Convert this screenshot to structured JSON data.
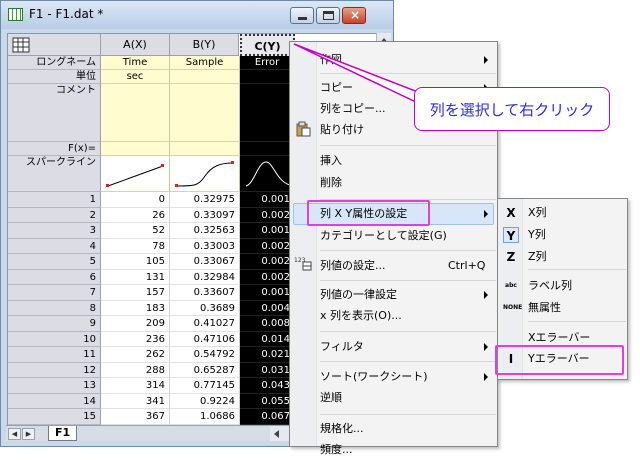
{
  "window": {
    "title": "F1 - F1.dat *",
    "sheet_tab": "F1"
  },
  "sheet": {
    "corner_icon": "table-layout-icon",
    "columns": [
      "A(X)",
      "B(Y)",
      "C(Y)"
    ],
    "row_labels": {
      "long_name": "ロングネーム",
      "units": "単位",
      "comment": "コメント",
      "fx": "F(x)=",
      "sparkline": "スパークライン"
    },
    "long_names": [
      "Time",
      "Sample",
      "Error"
    ],
    "units": [
      "sec",
      "",
      ""
    ],
    "rows": [
      {
        "n": "1",
        "a": "0",
        "b": "0.32975",
        "c": "0.001"
      },
      {
        "n": "2",
        "a": "26",
        "b": "0.33097",
        "c": "0.002"
      },
      {
        "n": "3",
        "a": "52",
        "b": "0.32563",
        "c": "0.001"
      },
      {
        "n": "4",
        "a": "78",
        "b": "0.33003",
        "c": "0.002"
      },
      {
        "n": "5",
        "a": "105",
        "b": "0.33067",
        "c": "0.002"
      },
      {
        "n": "6",
        "a": "131",
        "b": "0.32984",
        "c": "0.002"
      },
      {
        "n": "7",
        "a": "157",
        "b": "0.33607",
        "c": "0.001"
      },
      {
        "n": "8",
        "a": "183",
        "b": "0.3689",
        "c": "0.004"
      },
      {
        "n": "9",
        "a": "209",
        "b": "0.41027",
        "c": "0.008"
      },
      {
        "n": "10",
        "a": "236",
        "b": "0.47106",
        "c": "0.014"
      },
      {
        "n": "11",
        "a": "262",
        "b": "0.54792",
        "c": "0.021"
      },
      {
        "n": "12",
        "a": "288",
        "b": "0.65287",
        "c": "0.031"
      },
      {
        "n": "13",
        "a": "314",
        "b": "0.77145",
        "c": "0.043"
      },
      {
        "n": "14",
        "a": "341",
        "b": "0.9224",
        "c": "0.055"
      },
      {
        "n": "15",
        "a": "367",
        "b": "1.0686",
        "c": "0.067"
      }
    ]
  },
  "context_menu": {
    "items": [
      {
        "label": "作図",
        "submenu": true
      },
      {
        "label": "コピー",
        "submenu": true
      },
      {
        "label": "列をコピー..."
      },
      {
        "label": "貼り付け",
        "icon": "paste-icon"
      },
      {
        "label": "挿入"
      },
      {
        "label": "削除"
      },
      {
        "label": "列 X Y属性の設定",
        "submenu": true,
        "highlighted": true
      },
      {
        "label": "カテゴリーとして設定(G)"
      },
      {
        "label": "列値の設定...",
        "shortcut": "Ctrl+Q",
        "icon": "set-column-values-icon"
      },
      {
        "label": "列値の一律設定",
        "submenu": true
      },
      {
        "label": "x 列を表示(O)..."
      },
      {
        "label": "フィルタ",
        "submenu": true
      },
      {
        "label": "ソート(ワークシート)",
        "submenu": true
      },
      {
        "label": "逆順"
      },
      {
        "label": "規格化..."
      },
      {
        "label": "頻度..."
      }
    ]
  },
  "submenu": {
    "items": [
      {
        "label": "X列",
        "glyph": "X"
      },
      {
        "label": "Y列",
        "glyph": "Y",
        "checked": true
      },
      {
        "label": "Z列",
        "glyph": "Z"
      },
      {
        "label": "ラベル列",
        "glyph": "abc"
      },
      {
        "label": "無属性",
        "glyph": "NONE"
      },
      {
        "label": "Xエラーバー",
        "glyph": ""
      },
      {
        "label": "Yエラーバー",
        "glyph": "I",
        "boxed": true
      }
    ]
  },
  "annotation": {
    "text": "列を選択して右クリック"
  },
  "colors": {
    "accent_pink": "#e040e0",
    "callout_text": "#2d2de0",
    "selection": "#000000",
    "label_rows": "#fffccf"
  }
}
